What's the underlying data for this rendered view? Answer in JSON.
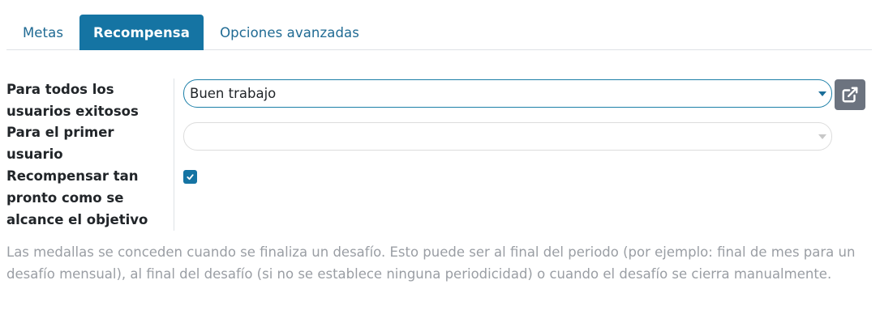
{
  "tabs": [
    {
      "label": "Metas",
      "active": false
    },
    {
      "label": "Recompensa",
      "active": true
    },
    {
      "label": "Opciones avanzadas",
      "active": false
    }
  ],
  "form": {
    "reward_all": {
      "label": "Para todos los usuarios exitosos",
      "value": "Buen trabajo"
    },
    "reward_first": {
      "label": "Para el primer usuario",
      "value": ""
    },
    "reward_realtime": {
      "label": "Recompensar tan pronto como se alcance el objetivo",
      "checked": true
    }
  },
  "help_text": "Las medallas se conceden cuando se finaliza un desafío. Esto puede ser al final del periodo (por ejemplo: final de mes para un desafío mensual), al final del desafío (si no se establece ninguna periodicidad) o cuando el desafío se cierra manualmente.",
  "icons": {
    "external_link": "external-link-icon",
    "caret": "caret-down-icon",
    "check": "check-icon"
  },
  "colors": {
    "primary": "#1574a3",
    "tab_text": "#1f6a93",
    "secondary_button": "#6c737f",
    "help_text": "#9a9ea4"
  }
}
